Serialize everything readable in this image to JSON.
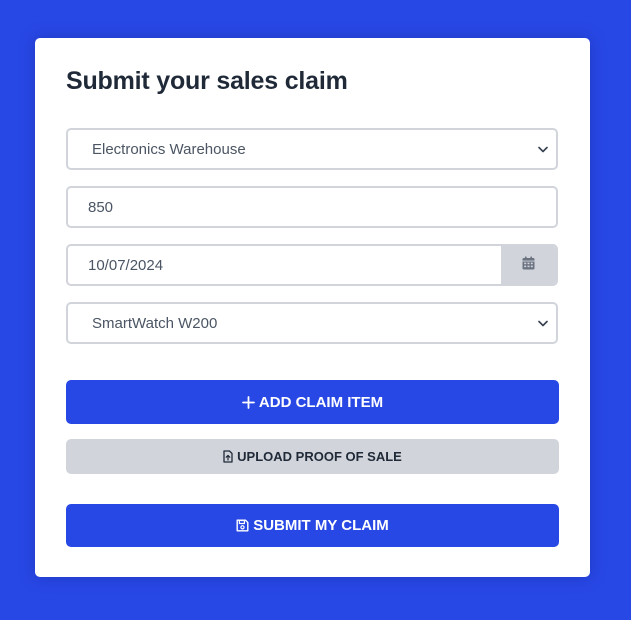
{
  "form": {
    "title": "Submit your sales claim",
    "retailer_select": {
      "selected": "Electronics Warehouse"
    },
    "amount_input": {
      "value": "850"
    },
    "date_input": {
      "value": "10/07/2024"
    },
    "product_select": {
      "selected": "SmartWatch W200"
    }
  },
  "buttons": {
    "add_item_label": "ADD CLAIM ITEM",
    "upload_label": "UPLOAD PROOF OF SALE",
    "submit_label": "SUBMIT MY CLAIM"
  },
  "icons": {
    "add": "plus-icon",
    "upload": "file-upload-icon",
    "submit": "floppy-disk-icon",
    "calendar": "calendar-icon",
    "dropdown": "chevron-down-icon"
  },
  "colors": {
    "page_background": "#2848e6",
    "primary_button": "#2848e6",
    "secondary_button": "#d1d5db",
    "title_text": "#1f2937",
    "field_border": "#d1d5db"
  }
}
